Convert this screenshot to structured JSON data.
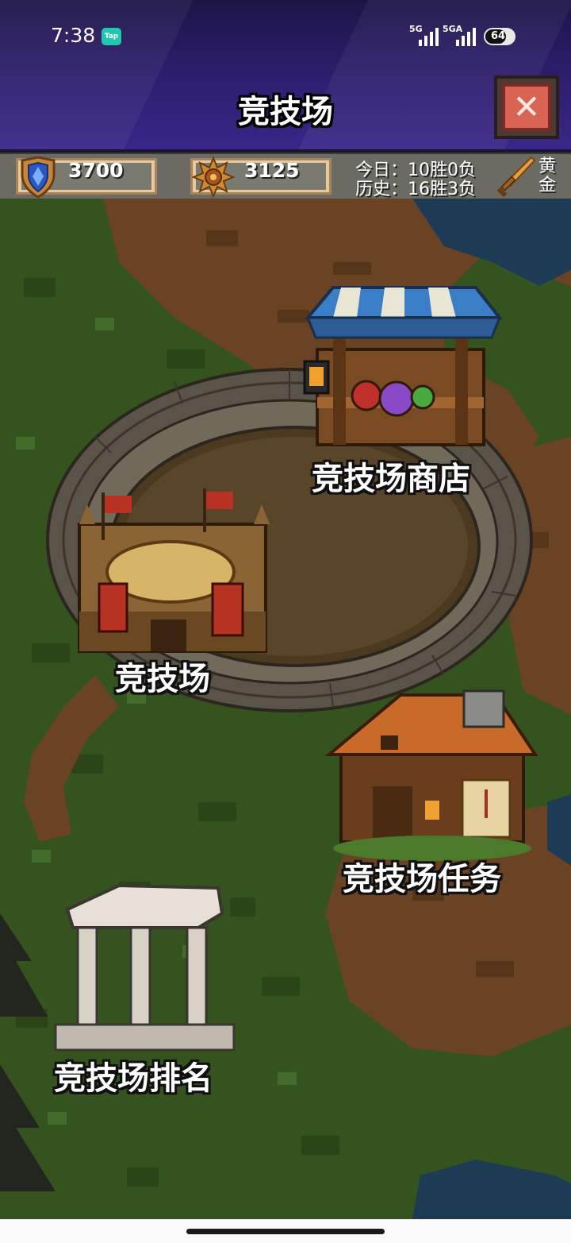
{
  "status_bar": {
    "time": "7:38",
    "app_badge": "Tap",
    "signal1_label": "5G",
    "signal2_label": "5GA",
    "battery": "64"
  },
  "header": {
    "title": "竞技场",
    "close_icon": "close-icon"
  },
  "stats": {
    "shield_value": "3700",
    "medal_value": "3125",
    "today_record": "今日：10胜0负",
    "history_record": "历史：16胜3负",
    "rank": "黄金"
  },
  "buildings": {
    "shop": "竞技场商店",
    "arena": "竞技场",
    "quest": "竞技场任务",
    "ranking": "竞技场排名"
  },
  "colors": {
    "header_bg": "#2a1c66",
    "grass": "#34531f",
    "dirt": "#6a4324",
    "water": "#1e3b56"
  }
}
